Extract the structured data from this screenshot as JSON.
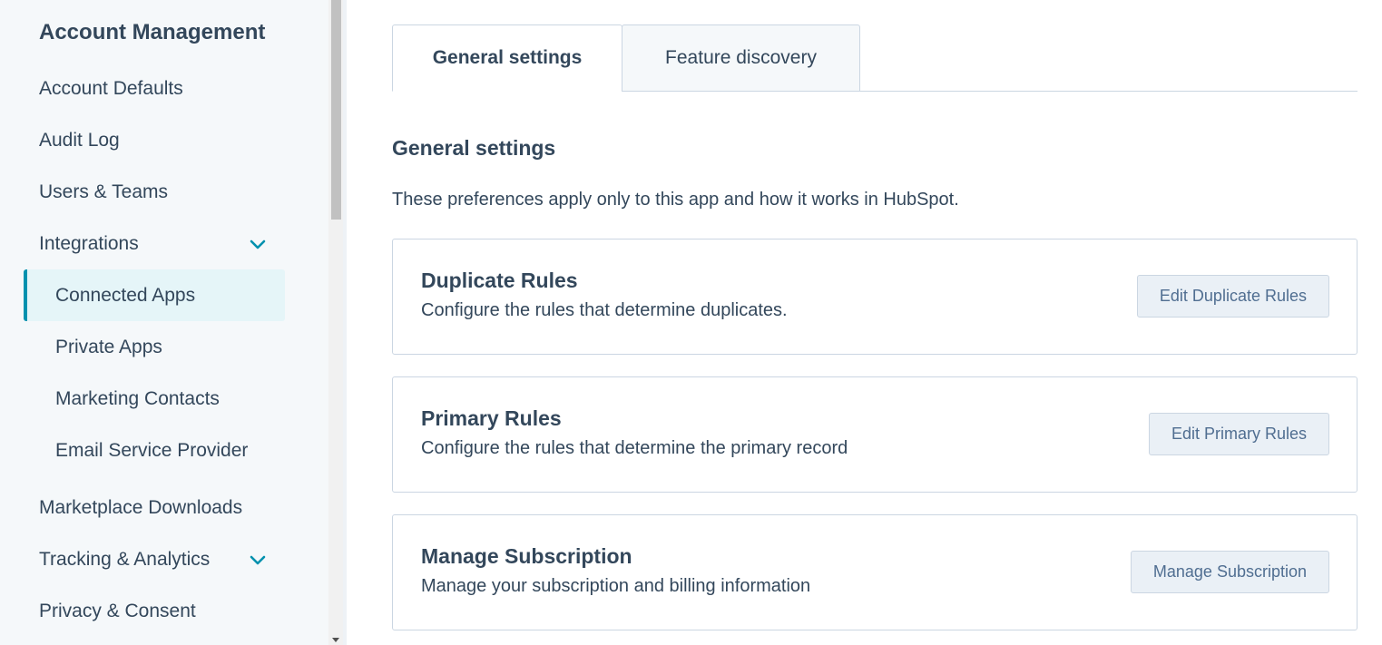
{
  "sidebar": {
    "heading": "Account Management",
    "items": [
      {
        "label": "Account Defaults"
      },
      {
        "label": "Audit Log"
      },
      {
        "label": "Users & Teams"
      },
      {
        "label": "Integrations",
        "expanded": true,
        "icon": "chevron-down-icon"
      },
      {
        "label": "Connected Apps",
        "active": true
      },
      {
        "label": "Private Apps"
      },
      {
        "label": "Marketing Contacts"
      },
      {
        "label": "Email Service Provider"
      },
      {
        "label": "Marketplace Downloads"
      },
      {
        "label": "Tracking & Analytics",
        "icon": "chevron-down-icon"
      },
      {
        "label": "Privacy & Consent"
      }
    ]
  },
  "tabs": [
    {
      "label": "General settings",
      "active": true
    },
    {
      "label": "Feature discovery",
      "active": false
    }
  ],
  "main": {
    "title": "General settings",
    "description": "These preferences apply only to this app and how it works in HubSpot.",
    "cards": [
      {
        "title": "Duplicate Rules",
        "description": "Configure the rules that determine duplicates.",
        "button": "Edit Duplicate Rules"
      },
      {
        "title": "Primary Rules",
        "description": "Configure the rules that determine the primary record",
        "button": "Edit Primary Rules"
      },
      {
        "title": "Manage Subscription",
        "description": "Manage your subscription and billing information",
        "button": "Manage Subscription"
      }
    ]
  },
  "colors": {
    "accent": "#0091ae",
    "text": "#33475b",
    "sidebar_bg": "#f5f8fa",
    "active_bg": "#e5f5f8"
  }
}
